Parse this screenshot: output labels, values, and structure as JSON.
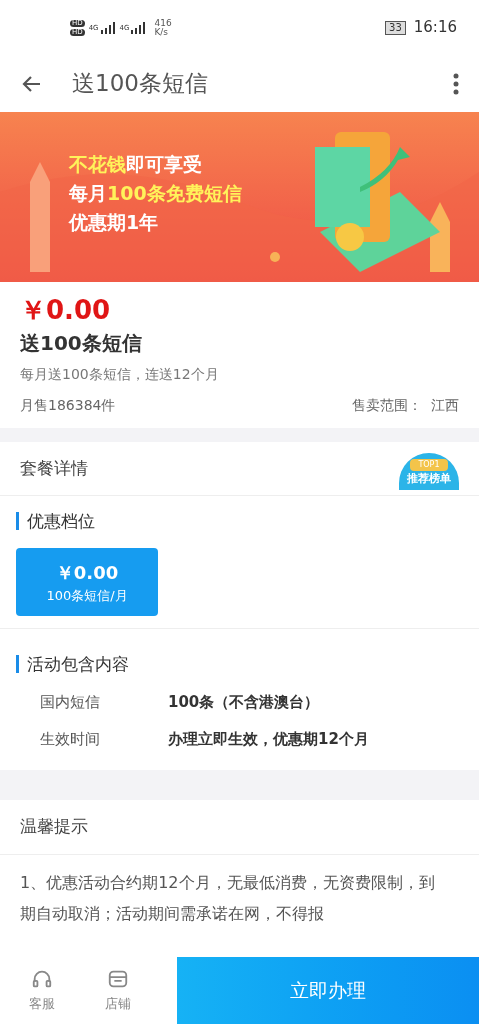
{
  "status_bar": {
    "hd_labels": [
      "HD",
      "HD"
    ],
    "network": [
      "4G",
      "4G"
    ],
    "speed": "416",
    "speed_unit": "K/s",
    "battery": "33",
    "time": "16:16"
  },
  "app_bar": {
    "title": "送100条短信"
  },
  "banner": {
    "lines": [
      [
        {
          "text": "不花钱",
          "highlight": true
        },
        {
          "text": "即可享受",
          "highlight": false
        }
      ],
      [
        {
          "text": "每月",
          "highlight": false
        },
        {
          "text": "100条免费短信",
          "highlight": true
        }
      ],
      [
        {
          "text": "优惠期1年",
          "highlight": false
        }
      ]
    ]
  },
  "product": {
    "price": "￥0.00",
    "name": "送100条短信",
    "description": "每月送100条短信，连送12个月",
    "monthly_sales": "月售186384件",
    "sales_area": "售卖范围：  江西"
  },
  "package_details": {
    "title": "套餐详情",
    "badge": "推荐榜单",
    "badge_top": "TOP1"
  },
  "tiers": {
    "title": "优惠档位",
    "options": [
      {
        "price": "￥0.00",
        "label": "100条短信/月",
        "selected": true
      }
    ]
  },
  "contents": {
    "title": "活动包含内容",
    "rows": [
      {
        "label": "国内短信",
        "value": "100条（不含港澳台）"
      },
      {
        "label": "生效时间",
        "value": "办理立即生效，优惠期12个月"
      }
    ]
  },
  "tips": {
    "title": "温馨提示",
    "text": "1、优惠活动合约期12个月，无最低消费，无资费限制，到期自动取消；活动期间需承诺在网，不得报"
  },
  "bottom_bar": {
    "items": [
      {
        "kind": "headset",
        "label": "客服"
      },
      {
        "kind": "store",
        "label": "店铺"
      }
    ],
    "action": "立即办理"
  }
}
